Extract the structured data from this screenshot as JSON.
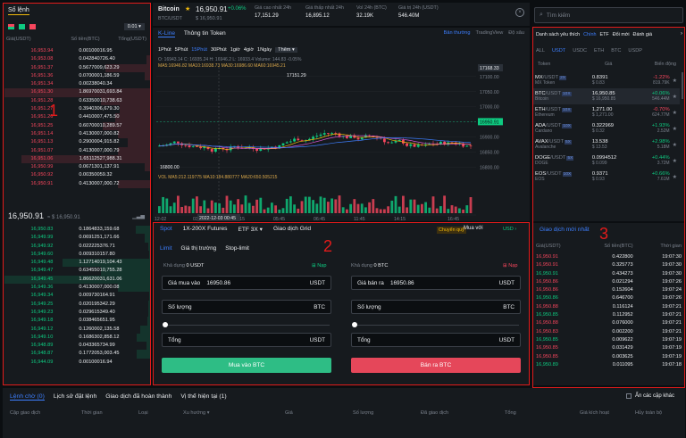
{
  "orderbook": {
    "title": "Sổ lệnh",
    "precision": "0.01",
    "headers": [
      "Giá(USDT)",
      "Số tiền(BTC)",
      "Tổng(USDT)"
    ],
    "asks": [
      [
        "16,953.94",
        "0.001000",
        "16.95"
      ],
      [
        "16,953.08",
        "0.042840",
        "726.40"
      ],
      [
        "16,951.37",
        "0.567700",
        "9,623.29"
      ],
      [
        "16,951.36",
        "0.070000",
        "1,186.59"
      ],
      [
        "16,951.34",
        "0.002380",
        "40.34"
      ],
      [
        "16,951.30",
        "1.869700",
        "31,693.84"
      ],
      [
        "16,951.28",
        "0.633500",
        "10,738.63"
      ],
      [
        "16,951.27",
        "0.394030",
        "6,679.30"
      ],
      [
        "16,951.26",
        "0.441000",
        "7,475.50"
      ],
      [
        "16,951.25",
        "0.607000",
        "10,289.57"
      ],
      [
        "16,951.14",
        "0.413000",
        "7,000.82"
      ],
      [
        "16,951.13",
        "0.290000",
        "4,915.82"
      ],
      [
        "16,951.07",
        "0.413000",
        "7,000.79"
      ],
      [
        "16,951.06",
        "1.651125",
        "27,988.31"
      ],
      [
        "16,950.99",
        "0.067130",
        "1,137.91"
      ],
      [
        "16,950.92",
        "0.003500",
        "59.32"
      ],
      [
        "16,950.91",
        "0.413000",
        "7,000.72"
      ]
    ],
    "last_price": "16,950.91",
    "last_price_ref": "≈ $ 16,950.91",
    "bids": [
      [
        "16,950.83",
        "0.186483",
        "3,159.68"
      ],
      [
        "16,949.99",
        "0.069125",
        "1,171.66"
      ],
      [
        "16,949.92",
        "0.022225",
        "376.71"
      ],
      [
        "16,949.60",
        "0.009310",
        "157.80"
      ],
      [
        "16,949.48",
        "1.127140",
        "19,104.43"
      ],
      [
        "16,949.47",
        "0.634550",
        "10,755.28"
      ],
      [
        "16,949.45",
        "1.866200",
        "31,631.06"
      ],
      [
        "16,949.36",
        "0.413000",
        "7,000.08"
      ],
      [
        "16,949.34",
        "0.009730",
        "164.91"
      ],
      [
        "16,949.25",
        "0.020195",
        "342.29"
      ],
      [
        "16,949.23",
        "0.029615",
        "349.40"
      ],
      [
        "16,949.18",
        "0.038465",
        "651.95"
      ],
      [
        "16,949.12",
        "0.126000",
        "2,135.58"
      ],
      [
        "16,949.10",
        "0.168630",
        "2,858.12"
      ],
      [
        "16,948.89",
        "0.043365",
        "734.99"
      ],
      [
        "16,948.87",
        "0.177205",
        "3,003.45"
      ],
      [
        "16,944.09",
        "0.001000",
        "16.94"
      ]
    ]
  },
  "ticker": {
    "symbol": "Bitcoin",
    "pair": "BTC/USDT",
    "price": "16,950.91",
    "change": "+0.06%",
    "ref": "$ 16,950.91",
    "stats": [
      {
        "label": "Giá cao nhất 24h",
        "value": "17,151.29"
      },
      {
        "label": "Giá thấp nhất 24h",
        "value": "16,895.12"
      },
      {
        "label": "Vol 24h (BTC)",
        "value": "32.19K"
      },
      {
        "label": "Giá trị 24h (USDT)",
        "value": "546.40M"
      }
    ]
  },
  "chart": {
    "tabs": [
      "K-Line",
      "Thông tin Token"
    ],
    "views": [
      "Bản thường",
      "TradingView",
      "Độ sâu"
    ],
    "intervals": [
      "1Phút",
      "5Phút",
      "15Phút",
      "30Phút",
      "1giờ",
      "4giờ",
      "1Ngày",
      "Thêm ▾"
    ],
    "ohlc": "O: 16943.14  C: 16935.24  H: 16946.2  L: 16933.4  Volume: 144.83  -0.05%",
    "ma": "MA5:16946.82  MA10:16938.73  MA30:16986.60  MA60:16945.21",
    "price_ticks": [
      "17100.00",
      "17050.00",
      "17000.00",
      "16950.00",
      "16900.00",
      "16850.00",
      "16800.00"
    ],
    "tag_high": "17168.33",
    "tag_current": "16950.91",
    "tag_low": "16800.00",
    "max_label": "17151.29",
    "min_label": "16800.00",
    "vol_line": "VOL  MA5:212.119775  MA10:184.880777  MA20:650.505215",
    "time_ticks": [
      "12-02",
      "03:45",
      "04:15",
      "05:45",
      "06:45",
      "11:45",
      "14:15",
      "16:45"
    ],
    "crosshair_time": "2022-12-03 00:45"
  },
  "trade": {
    "tabs": [
      "Spot",
      "1X-200X Futures",
      "ETF 3X ▾",
      "Giao dịch Grid"
    ],
    "transfer": "Chuyển quỹ",
    "buy_with": "Mua với",
    "currency": "USD",
    "order_types": [
      "Limit",
      "Giá thị trường",
      "Stop-limit"
    ],
    "buy": {
      "available_label": "Khả dụng",
      "available": "0 USDT",
      "deposit": "Nạp",
      "price_label": "Giá mua vào",
      "price": "16950.86",
      "price_unit": "USDT",
      "qty_label": "Số lượng",
      "qty_unit": "BTC",
      "total_label": "Tổng",
      "total_unit": "USDT",
      "button": "Mua vào BTC"
    },
    "sell": {
      "available_label": "Khả dụng",
      "available": "0 BTC",
      "deposit": "Nạp",
      "price_label": "Giá bán ra",
      "price": "16950.86",
      "price_unit": "USDT",
      "qty_label": "Số lượng",
      "qty_unit": "BTC",
      "total_label": "Tổng",
      "total_unit": "USDT",
      "button": "Bán ra BTC"
    }
  },
  "markets": {
    "search_placeholder": "Tìm kiếm",
    "tabs": [
      "Danh sách yêu thích",
      "Chính",
      "ETF",
      "Đổi mới",
      "Đánh giá"
    ],
    "quotes": [
      "ALL",
      "USDT",
      "USDC",
      "ETH",
      "BTC",
      "USDP"
    ],
    "headers": [
      "Token",
      "Giá",
      "Biến động"
    ],
    "rows": [
      {
        "sym": "MX",
        "quote": "/USDT",
        "lev": "2X",
        "name": "MX Token",
        "price": "0.8391",
        "ref": "$ 0.83",
        "chg": "-1.22%",
        "vol": "819.79K",
        "dir": "down"
      },
      {
        "sym": "BTC",
        "quote": "/USDT",
        "lev": "10X",
        "name": "Bitcoin",
        "price": "16,950.85",
        "ref": "$ 16,950.85",
        "chg": "+0.06%",
        "vol": "546.44M",
        "dir": "up"
      },
      {
        "sym": "ETH",
        "quote": "/USDT",
        "lev": "10X",
        "name": "Ethereum",
        "price": "1,271.00",
        "ref": "$ 1,271.00",
        "chg": "-0.70%",
        "vol": "624.77M",
        "dir": "down"
      },
      {
        "sym": "ADA",
        "quote": "/USDT",
        "lev": "10X",
        "name": "Cardano",
        "price": "0.322969",
        "ref": "$ 0.32",
        "chg": "+1.93%",
        "vol": "2.52M",
        "dir": "up"
      },
      {
        "sym": "AVAX",
        "quote": "/USDT",
        "lev": "5X",
        "name": "Avalanche",
        "price": "13.538",
        "ref": "$ 13.53",
        "chg": "+2.98%",
        "vol": "5.18M",
        "dir": "up"
      },
      {
        "sym": "DOGE",
        "quote": "/USDT",
        "lev": "5X",
        "name": "DOGE",
        "price": "0.0994512",
        "ref": "$ 0.099",
        "chg": "+0.44%",
        "vol": "3.72M",
        "dir": "up"
      },
      {
        "sym": "EOS",
        "quote": "/USDT",
        "lev": "10X",
        "name": "EOS",
        "price": "0.9371",
        "ref": "$ 0.93",
        "chg": "+0.66%",
        "vol": "7.61M",
        "dir": "up"
      }
    ]
  },
  "trades": {
    "title": "Giao dịch mới nhất",
    "headers": [
      "Giá(USDT)",
      "Số tiền(BTC)",
      "Thời gian"
    ],
    "rows": [
      [
        "16,950.91",
        "0.422800",
        "19:07:30",
        "down"
      ],
      [
        "16,950.91",
        "0.325773",
        "19:07:30",
        "down"
      ],
      [
        "16,950.91",
        "0.434273",
        "19:07:30",
        "up"
      ],
      [
        "16,950.86",
        "0.021294",
        "19:07:26",
        "down"
      ],
      [
        "16,950.86",
        "0.152604",
        "19:07:24",
        "down"
      ],
      [
        "16,950.86",
        "0.646700",
        "19:07:26",
        "up"
      ],
      [
        "16,950.88",
        "0.116124",
        "19:07:21",
        "down"
      ],
      [
        "16,950.85",
        "0.112952",
        "19:07:21",
        "up"
      ],
      [
        "16,950.88",
        "0.076000",
        "19:07:21",
        "down"
      ],
      [
        "16,950.83",
        "0.002200",
        "19:07:21",
        "down"
      ],
      [
        "16,950.85",
        "0.009622",
        "19:07:19",
        "up"
      ],
      [
        "16,950.85",
        "0.031429",
        "19:07:19",
        "down"
      ],
      [
        "16,950.85",
        "0.003625",
        "19:07:19",
        "down"
      ],
      [
        "16,950.89",
        "0.011095",
        "19:07:18",
        "up"
      ]
    ]
  },
  "bottom": {
    "tabs": [
      "Lệnh chờ (0)",
      "Lịch sử đặt lệnh",
      "Giao dịch đã hoàn thành",
      "Vị thế hiện tại (1)"
    ],
    "hide_label": "Ẩn các cặp khác",
    "columns": [
      "Cặp giao dịch",
      "Thời gian",
      "Loại",
      "Xu hướng ▾",
      "Giá",
      "Số lượng",
      "Đã giao dịch",
      "Tổng",
      "Giá kích hoạt",
      "Hủy toàn bộ"
    ]
  },
  "annotations": [
    "1",
    "2",
    "3"
  ]
}
